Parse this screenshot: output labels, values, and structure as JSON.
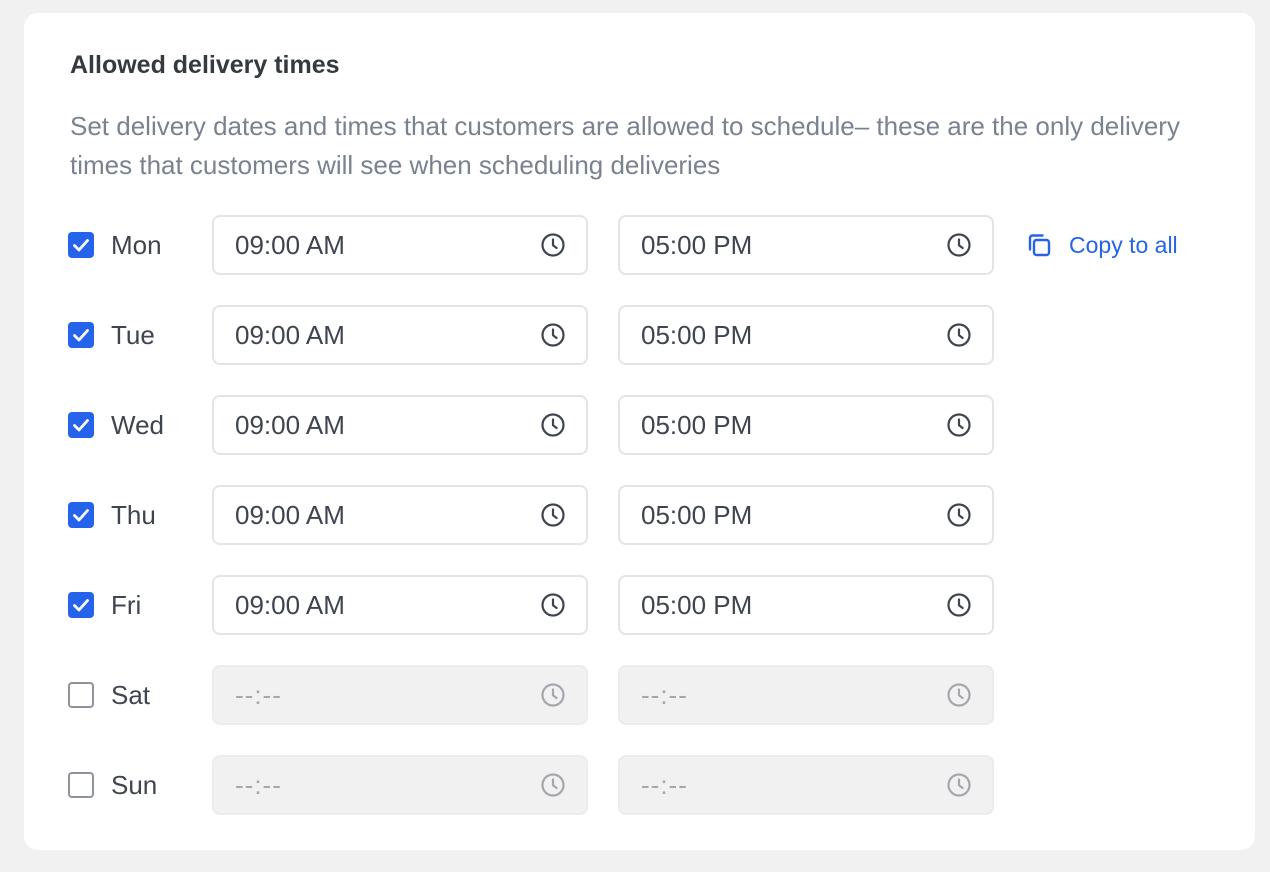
{
  "section": {
    "title": "Allowed delivery times",
    "description": "Set delivery dates and times that customers are allowed to schedule– these are the only delivery times that customers will see when scheduling deliveries"
  },
  "copy_to_all": {
    "label": "Copy to all",
    "icon": "copy-icon"
  },
  "days": [
    {
      "label": "Mon",
      "checked": true,
      "start": "09:00 AM",
      "end": "05:00 PM"
    },
    {
      "label": "Tue",
      "checked": true,
      "start": "09:00 AM",
      "end": "05:00 PM"
    },
    {
      "label": "Wed",
      "checked": true,
      "start": "09:00 AM",
      "end": "05:00 PM"
    },
    {
      "label": "Thu",
      "checked": true,
      "start": "09:00 AM",
      "end": "05:00 PM"
    },
    {
      "label": "Fri",
      "checked": true,
      "start": "09:00 AM",
      "end": "05:00 PM"
    },
    {
      "label": "Sat",
      "checked": false,
      "start": "--:--",
      "end": "--:--"
    },
    {
      "label": "Sun",
      "checked": false,
      "start": "--:--",
      "end": "--:--"
    }
  ],
  "colors": {
    "accent": "#2563eb",
    "icon": "#3f4550",
    "icon_disabled": "#a4a8ae"
  }
}
